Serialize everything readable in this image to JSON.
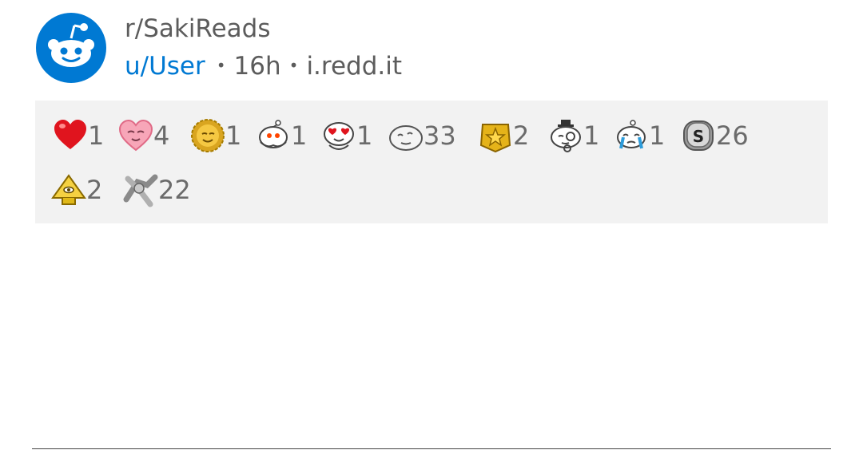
{
  "post": {
    "subreddit": "r/SakiReads",
    "user": "u/User",
    "age": "16h",
    "domain": "i.redd.it",
    "separator": "•"
  },
  "awards": [
    {
      "icon": "heart-icon",
      "count": "1"
    },
    {
      "icon": "wholesome-heart-icon",
      "count": "4"
    },
    {
      "icon": "sun-face-icon",
      "count": "1"
    },
    {
      "icon": "snoo-hugs-icon",
      "count": "1"
    },
    {
      "icon": "snoo-love-eyes-icon",
      "count": "1"
    },
    {
      "icon": "blob-face-icon",
      "count": "33"
    },
    {
      "icon": "gold-star-badge-icon",
      "count": "2"
    },
    {
      "icon": "snoo-monocle-icon",
      "count": "1"
    },
    {
      "icon": "snoo-crying-icon",
      "count": "1"
    },
    {
      "icon": "silver-coin-icon",
      "count": "26"
    },
    {
      "icon": "gold-pyramid-icon",
      "count": "2"
    },
    {
      "icon": "handshake-icon",
      "count": "22"
    }
  ],
  "colors": {
    "brand": "#0079d3",
    "text": "#5c5c5c",
    "award_strip_bg": "#f2f2f2"
  }
}
